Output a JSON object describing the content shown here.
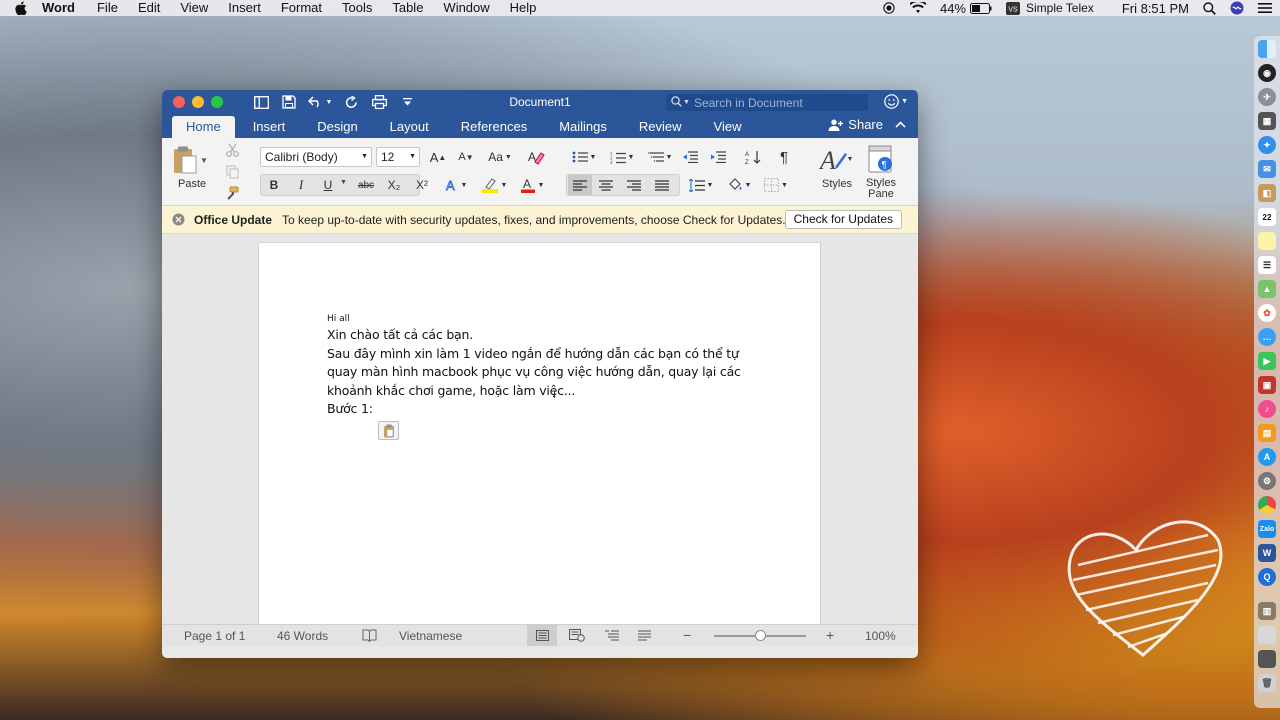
{
  "menubar": {
    "app_name": "Word",
    "items": [
      "File",
      "Edit",
      "View",
      "Insert",
      "Format",
      "Tools",
      "Table",
      "Window",
      "Help"
    ],
    "battery": "44%",
    "input_source": "Simple Telex",
    "clock": "Fri 8:51 PM"
  },
  "window": {
    "title": "Document1",
    "search_placeholder": "Search in Document",
    "tabs": [
      "Home",
      "Insert",
      "Design",
      "Layout",
      "References",
      "Mailings",
      "Review",
      "View"
    ],
    "active_tab": "Home",
    "share_label": "Share"
  },
  "ribbon": {
    "paste_label": "Paste",
    "font_name": "Calibri (Body)",
    "font_size": "12",
    "styles_label": "Styles",
    "styles_pane_label_1": "Styles",
    "styles_pane_label_2": "Pane",
    "bold": "B",
    "italic": "I",
    "underline": "U",
    "strike": "abc",
    "subscript": "X₂",
    "superscript": "X²",
    "pilcrow": "¶"
  },
  "notification": {
    "title": "Office Update",
    "message": "To keep up-to-date with security updates, fixes, and improvements, choose Check for Updates.",
    "button": "Check for Updates"
  },
  "document": {
    "line_small": "Hi all",
    "line1": "Xin chào tất cả các bạn.",
    "line2": "Sau đây mình xin làm 1 video ngắn để hướng dẫn các bạn có thể tự",
    "line3": "quay màn hình macbook phục vụ công việc hướng dẫn, quay lại các",
    "line4": "khoảnh khắc chơi game, hoặc làm việc...",
    "line5": "Bước 1:"
  },
  "status": {
    "page": "Page 1 of 1",
    "words": "46 Words",
    "language": "Vietnamese",
    "zoom_minus": "−",
    "zoom_plus": "+",
    "zoom": "100%",
    "zoom_fraction": 0.5
  },
  "colors": {
    "word_blue": "#2b579a",
    "notify_bg": "#fcf3d3",
    "highlight_yellow": "#ffe600",
    "font_red": "#e02020"
  }
}
